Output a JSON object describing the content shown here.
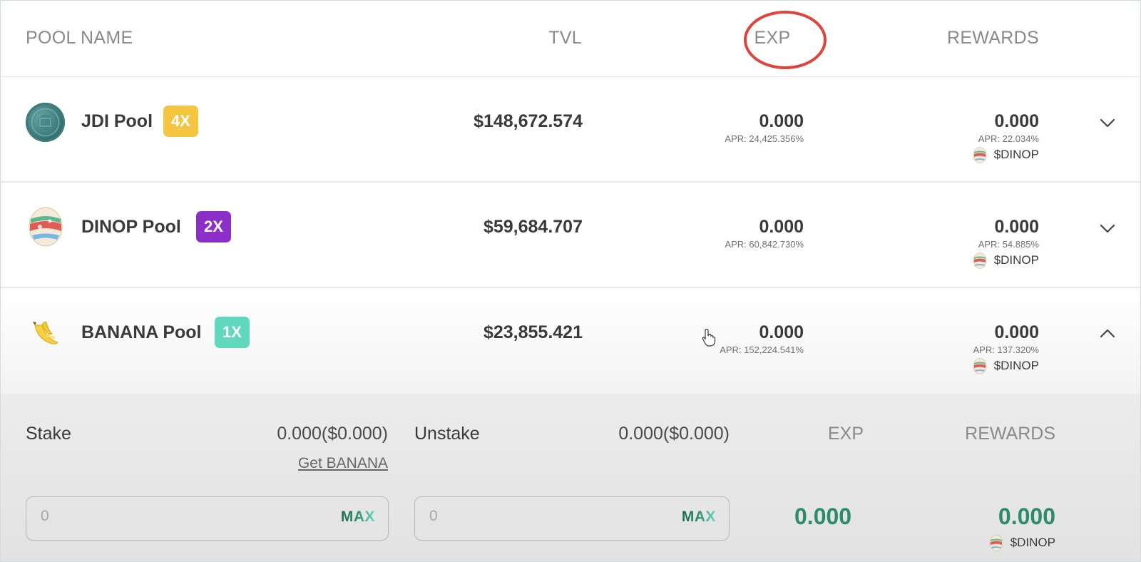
{
  "header": {
    "pool_name": "POOL NAME",
    "tvl": "TVL",
    "exp": "EXP",
    "rewards": "REWARDS"
  },
  "pools": [
    {
      "name": "JDI Pool",
      "multiplier": "4X",
      "multiplier_color": "#f5c542",
      "tvl": "$148,672.574",
      "exp": "0.000",
      "exp_apr": "APR: 24,425.356%",
      "rewards": "0.000",
      "rewards_apr": "APR: 22.034%",
      "reward_token": "$DINOP",
      "icon": "jdi-coin-icon",
      "expanded": false
    },
    {
      "name": "DINOP Pool",
      "multiplier": "2X",
      "multiplier_color": "#8e2ec8",
      "tvl": "$59,684.707",
      "exp": "0.000",
      "exp_apr": "APR: 60,842.730%",
      "rewards": "0.000",
      "rewards_apr": "APR: 54.885%",
      "reward_token": "$DINOP",
      "icon": "dinop-egg-icon",
      "expanded": false
    },
    {
      "name": "BANANA Pool",
      "multiplier": "1X",
      "multiplier_color": "#5fd8bd",
      "tvl": "$23,855.421",
      "exp": "0.000",
      "exp_apr": "APR: 152,224.541%",
      "rewards": "0.000",
      "rewards_apr": "APR: 137.320%",
      "reward_token": "$DINOP",
      "icon": "banana-icon",
      "expanded": true
    }
  ],
  "detail": {
    "stake_label": "Stake",
    "stake_amount": "0.000($0.000)",
    "get_link": "Get BANANA",
    "stake_placeholder": "0",
    "max_label": "MAX",
    "unstake_label": "Unstake",
    "unstake_amount": "0.000($0.000)",
    "unstake_placeholder": "0",
    "exp_title": "EXP",
    "exp_value": "0.000",
    "rewards_title": "REWARDS",
    "rewards_value": "0.000",
    "reward_token": "$DINOP"
  },
  "colors": {
    "accent_green": "#2b8b6a",
    "highlight_circle": "#e0433a"
  }
}
